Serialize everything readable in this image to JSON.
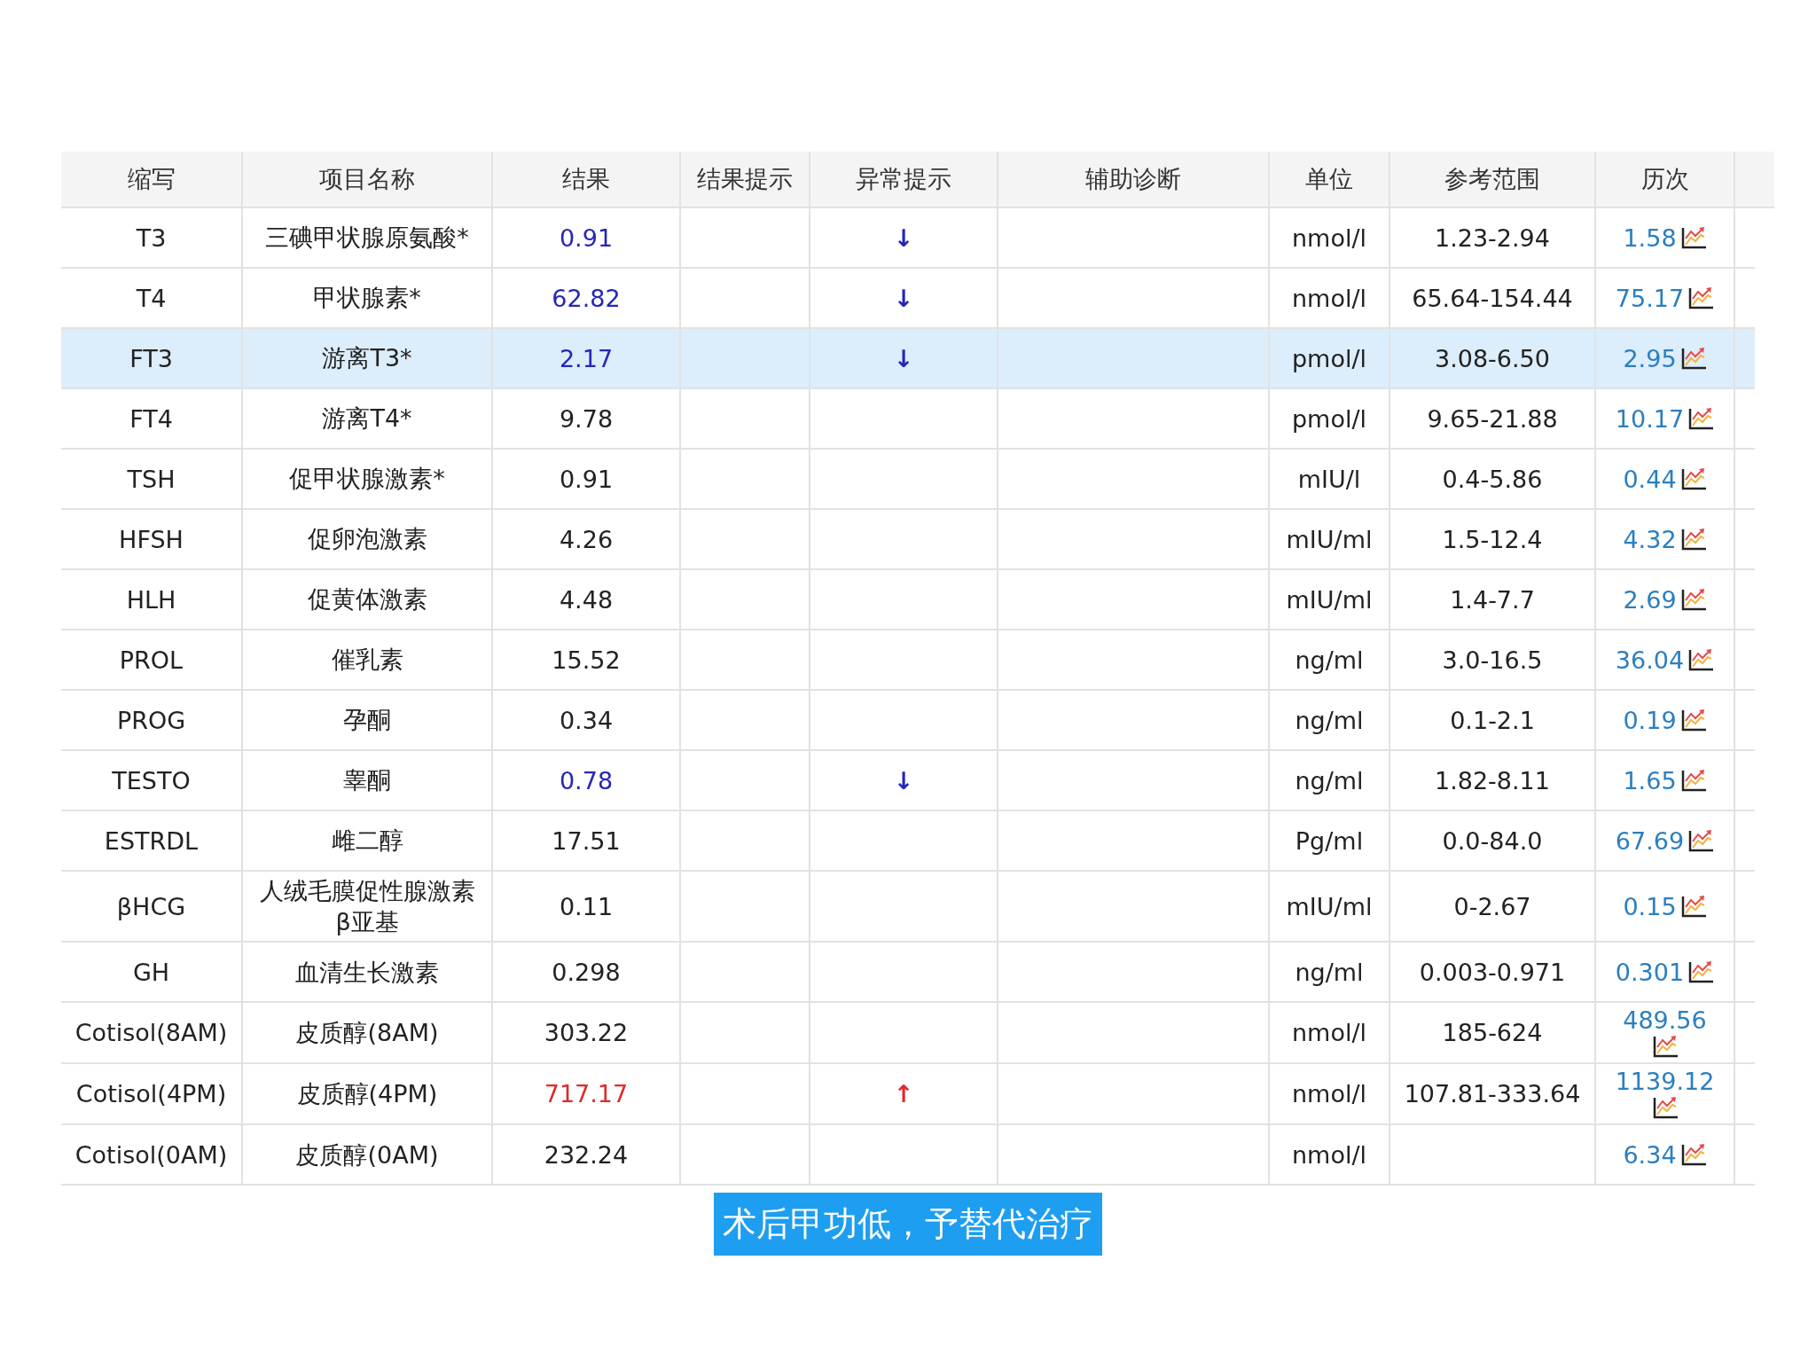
{
  "table": {
    "columns": [
      "缩写",
      "项目名称",
      "结果",
      "结果提示",
      "异常提示",
      "辅助诊断",
      "单位",
      "参考范围",
      "历次"
    ],
    "rows": [
      {
        "abbr": "T3",
        "name": "三碘甲状腺原氨酸*",
        "result": "0.91",
        "below_range": true,
        "above_range": false,
        "alert": "↓",
        "unit": "nmol/l",
        "range": "1.23-2.94",
        "history": "1.58",
        "selected": false
      },
      {
        "abbr": "T4",
        "name": "甲状腺素*",
        "result": "62.82",
        "below_range": true,
        "above_range": false,
        "alert": "↓",
        "unit": "nmol/l",
        "range": "65.64-154.44",
        "history": "75.17",
        "selected": false
      },
      {
        "abbr": "FT3",
        "name": "游离T3*",
        "result": "2.17",
        "below_range": true,
        "above_range": false,
        "alert": "↓",
        "unit": "pmol/l",
        "range": "3.08-6.50",
        "history": "2.95",
        "selected": true
      },
      {
        "abbr": "FT4",
        "name": "游离T4*",
        "result": "9.78",
        "below_range": false,
        "above_range": false,
        "unit": "pmol/l",
        "range": "9.65-21.88",
        "history": "10.17",
        "selected": false
      },
      {
        "abbr": "TSH",
        "name": "促甲状腺激素*",
        "result": "0.91",
        "below_range": false,
        "above_range": false,
        "unit": "mIU/l",
        "range": "0.4-5.86",
        "history": "0.44",
        "selected": false
      },
      {
        "abbr": "HFSH",
        "name": "促卵泡激素",
        "result": "4.26",
        "below_range": false,
        "above_range": false,
        "unit": "mIU/ml",
        "range": "1.5-12.4",
        "history": "4.32",
        "selected": false
      },
      {
        "abbr": "HLH",
        "name": "促黄体激素",
        "result": "4.48",
        "below_range": false,
        "above_range": false,
        "unit": "mIU/ml",
        "range": "1.4-7.7",
        "history": "2.69",
        "selected": false
      },
      {
        "abbr": "PROL",
        "name": "催乳素",
        "result": "15.52",
        "below_range": false,
        "above_range": false,
        "unit": "ng/ml",
        "range": "3.0-16.5",
        "history": "36.04",
        "selected": false
      },
      {
        "abbr": "PROG",
        "name": "孕酮",
        "result": "0.34",
        "below_range": false,
        "above_range": false,
        "unit": "ng/ml",
        "range": "0.1-2.1",
        "history": "0.19",
        "selected": false
      },
      {
        "abbr": "TESTO",
        "name": "睾酮",
        "result": "0.78",
        "below_range": true,
        "above_range": false,
        "alert": "↓",
        "unit": "ng/ml",
        "range": "1.82-8.11",
        "history": "1.65",
        "selected": false
      },
      {
        "abbr": "ESTRDL",
        "name": "雌二醇",
        "result": "17.51",
        "below_range": false,
        "above_range": false,
        "unit": "Pg/ml",
        "range": "0.0-84.0",
        "history": "67.69",
        "selected": false
      },
      {
        "abbr": "βHCG",
        "name": "人绒毛膜促性腺激素β亚基",
        "result": "0.11",
        "below_range": false,
        "above_range": false,
        "unit": "mIU/ml",
        "range": "0-2.67",
        "history": "0.15",
        "selected": false
      },
      {
        "abbr": "GH",
        "name": "血清生长激素",
        "result": "0.298",
        "below_range": false,
        "above_range": false,
        "unit": "ng/ml",
        "range": "0.003-0.971",
        "history": "0.301",
        "selected": false
      },
      {
        "abbr": "Cotisol(8AM)",
        "name": "皮质醇(8AM)",
        "result": "303.22",
        "below_range": false,
        "above_range": false,
        "unit": "nmol/l",
        "range": "185-624",
        "history": "489.56",
        "selected": false
      },
      {
        "abbr": "Cotisol(4PM)",
        "name": "皮质醇(4PM)",
        "result": "717.17",
        "below_range": false,
        "above_range": true,
        "alert": "↑",
        "unit": "nmol/l",
        "range": "107.81-333.64",
        "history": "1139.12",
        "selected": false
      },
      {
        "abbr": "Cotisol(0AM)",
        "name": "皮质醇(0AM)",
        "result": "232.24",
        "below_range": false,
        "above_range": false,
        "unit": "nmol/l",
        "history": "6.34",
        "selected": false
      }
    ]
  },
  "caption": "术后甲功低，予替代治疗"
}
